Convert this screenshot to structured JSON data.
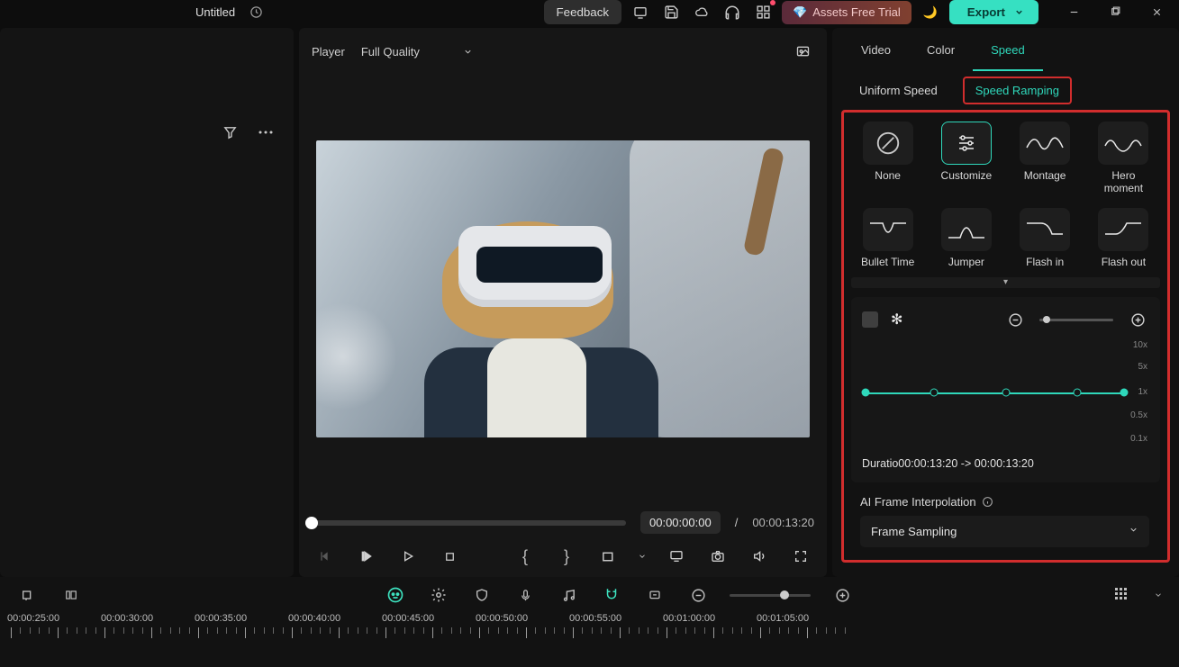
{
  "topbar": {
    "title": "Untitled",
    "feedback": "Feedback",
    "trial": "Assets Free Trial",
    "export": "Export"
  },
  "player": {
    "label": "Player",
    "quality": "Full Quality",
    "current": "00:00:00:00",
    "sep": "/",
    "duration": "00:00:13:20"
  },
  "panel": {
    "tabs": {
      "video": "Video",
      "color": "Color",
      "speed": "Speed"
    },
    "subtabs": {
      "uniform": "Uniform Speed",
      "ramping": "Speed Ramping"
    },
    "presets": {
      "none": "None",
      "customize": "Customize",
      "montage": "Montage",
      "hero": "Hero moment",
      "bullet": "Bullet Time",
      "jumper": "Jumper",
      "flashin": "Flash in",
      "flashout": "Flash out"
    },
    "yscale": {
      "x10": "10x",
      "x5": "5x",
      "x1": "1x",
      "x05": "0.5x",
      "x01": "0.1x"
    },
    "duration_prefix": "Duratio",
    "duration_value": "00:00:13:20 -> 00:00:13:20",
    "ai_label": "AI Frame Interpolation",
    "ai_value": "Frame Sampling"
  },
  "timeline": {
    "labels": [
      "00:00:25:00",
      "00:00:30:00",
      "00:00:35:00",
      "00:00:40:00",
      "00:00:45:00",
      "00:00:50:00",
      "00:00:55:00",
      "00:01:00:00",
      "00:01:05:00"
    ]
  }
}
